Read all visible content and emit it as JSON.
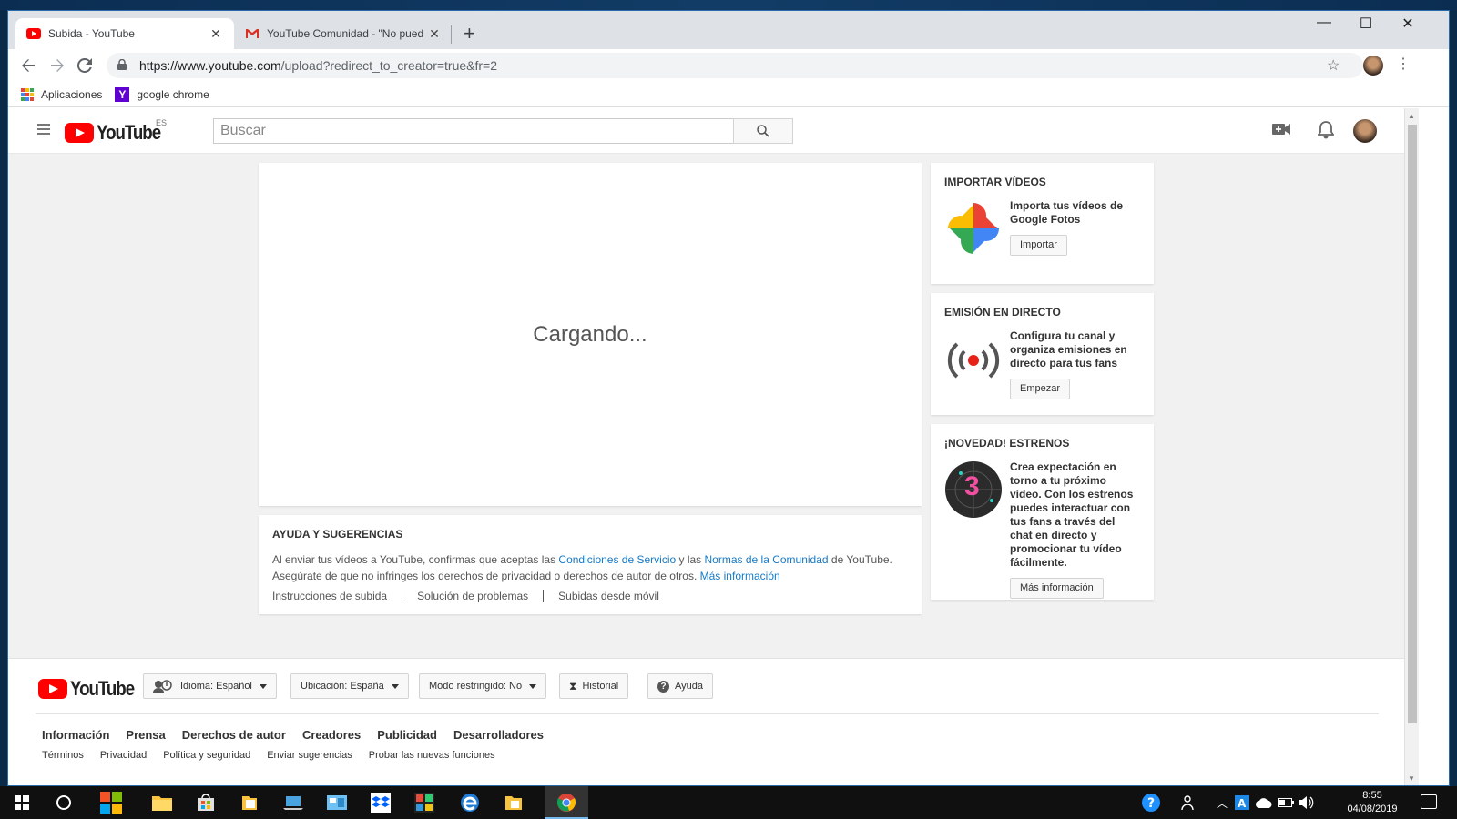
{
  "browser": {
    "tabs": [
      {
        "title": "Subida - YouTube",
        "active": true
      },
      {
        "title": "YouTube Comunidad - \"No pued",
        "active": false
      }
    ],
    "url_host": "https://www.youtube.com",
    "url_path": "/upload?redirect_to_creator=true&fr=2",
    "bookmarks": [
      {
        "label": "Aplicaciones"
      },
      {
        "label": "google chrome"
      }
    ]
  },
  "youtube": {
    "logo_text": "YouTube",
    "region": "ES",
    "search_placeholder": "Buscar",
    "loading": "Cargando...",
    "help": {
      "title": "AYUDA Y SUGERENCIAS",
      "line1_a": "Al enviar tus vídeos a YouTube, confirmas que aceptas las ",
      "line1_link1": "Condiciones de Servicio",
      "line1_b": " y las ",
      "line1_link2": "Normas de la Comunidad",
      "line1_c": " de YouTube.",
      "line2": "Asegúrate de que no infringes los derechos de privacidad o derechos de autor de otros. ",
      "line2_link": "Más información",
      "links": [
        "Instrucciones de subida",
        "Solución de problemas",
        "Subidas desde móvil"
      ]
    },
    "side": {
      "import": {
        "title": "IMPORTAR VÍDEOS",
        "text": "Importa tus vídeos de Google Fotos",
        "button": "Importar"
      },
      "live": {
        "title": "EMISIÓN EN DIRECTO",
        "text": "Configura tu canal y organiza emisiones en directo para tus fans",
        "button": "Empezar"
      },
      "premieres": {
        "title": "¡NOVEDAD! ESTRENOS",
        "text": "Crea expectación en torno a tu próximo vídeo. Con los estrenos puedes interactuar con tus fans a través del chat en directo y promocionar tu vídeo fácilmente.",
        "button": "Más información",
        "badge": "3"
      }
    },
    "footer": {
      "language": "Idioma: Español",
      "location": "Ubicación: España",
      "restricted": "Modo restringido: No",
      "history": "Historial",
      "help": "Ayuda",
      "links1": [
        "Información",
        "Prensa",
        "Derechos de autor",
        "Creadores",
        "Publicidad",
        "Desarrolladores"
      ],
      "links2": [
        "Términos",
        "Privacidad",
        "Política y seguridad",
        "Enviar sugerencias",
        "Probar las nuevas funciones"
      ]
    }
  },
  "taskbar": {
    "time": "8:55",
    "date": "04/08/2019"
  },
  "colors": {
    "yt_red": "#ff0000",
    "link_blue": "#167ac6"
  }
}
